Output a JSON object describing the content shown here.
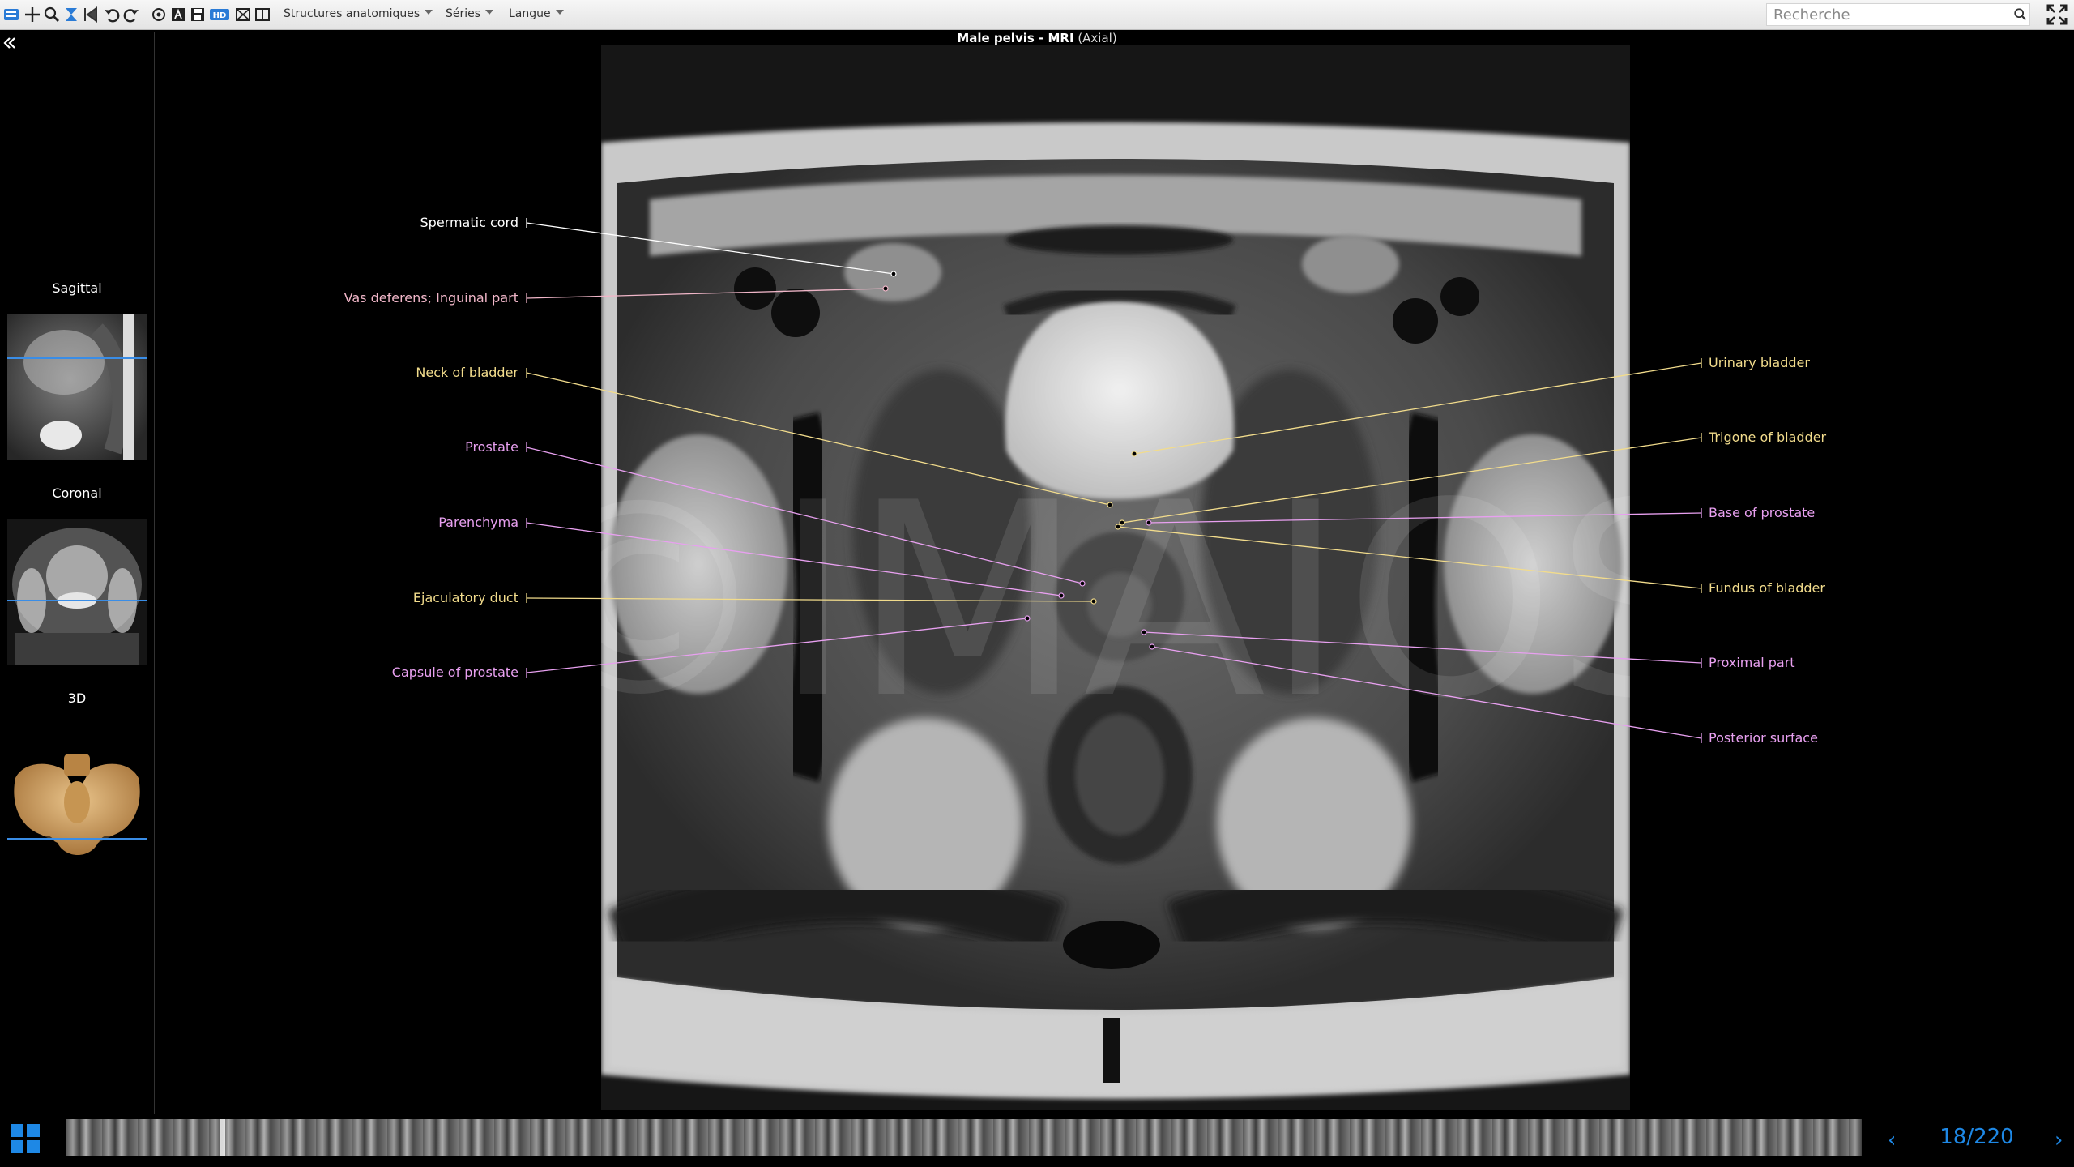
{
  "toolbar": {
    "menus": [
      {
        "label": "Structures anatomiques"
      },
      {
        "label": "Séries"
      },
      {
        "label": "Langue"
      }
    ],
    "search_placeholder": "Recherche"
  },
  "viewer": {
    "title": "Male pelvis - MRI",
    "subtitle": "(Axial)",
    "watermark": "©IMAIOS"
  },
  "sidepanel": {
    "views": [
      {
        "label": "Sagittal"
      },
      {
        "label": "Coronal"
      },
      {
        "label": "3D"
      }
    ]
  },
  "labels_left": [
    {
      "text": "Spermatic cord",
      "color": "#ffffff"
    },
    {
      "text": "Vas deferens; Inguinal part",
      "color": "#f0b6c8"
    },
    {
      "text": "Neck of bladder",
      "color": "#f2dc8c"
    },
    {
      "text": "Prostate",
      "color": "#e8a0f0"
    },
    {
      "text": "Parenchyma",
      "color": "#e8a0f0"
    },
    {
      "text": "Ejaculatory duct",
      "color": "#f2dc8c"
    },
    {
      "text": "Capsule of prostate",
      "color": "#e8a0f0"
    }
  ],
  "labels_right": [
    {
      "text": "Urinary bladder",
      "color": "#f2dc8c"
    },
    {
      "text": "Trigone of bladder",
      "color": "#f2dc8c"
    },
    {
      "text": "Base of prostate",
      "color": "#e8a0f0"
    },
    {
      "text": "Fundus of bladder",
      "color": "#f2dc8c"
    },
    {
      "text": "Proximal part",
      "color": "#e8a0f0"
    },
    {
      "text": "Posterior surface",
      "color": "#e8a0f0"
    }
  ],
  "pager": {
    "current": "18/220"
  }
}
